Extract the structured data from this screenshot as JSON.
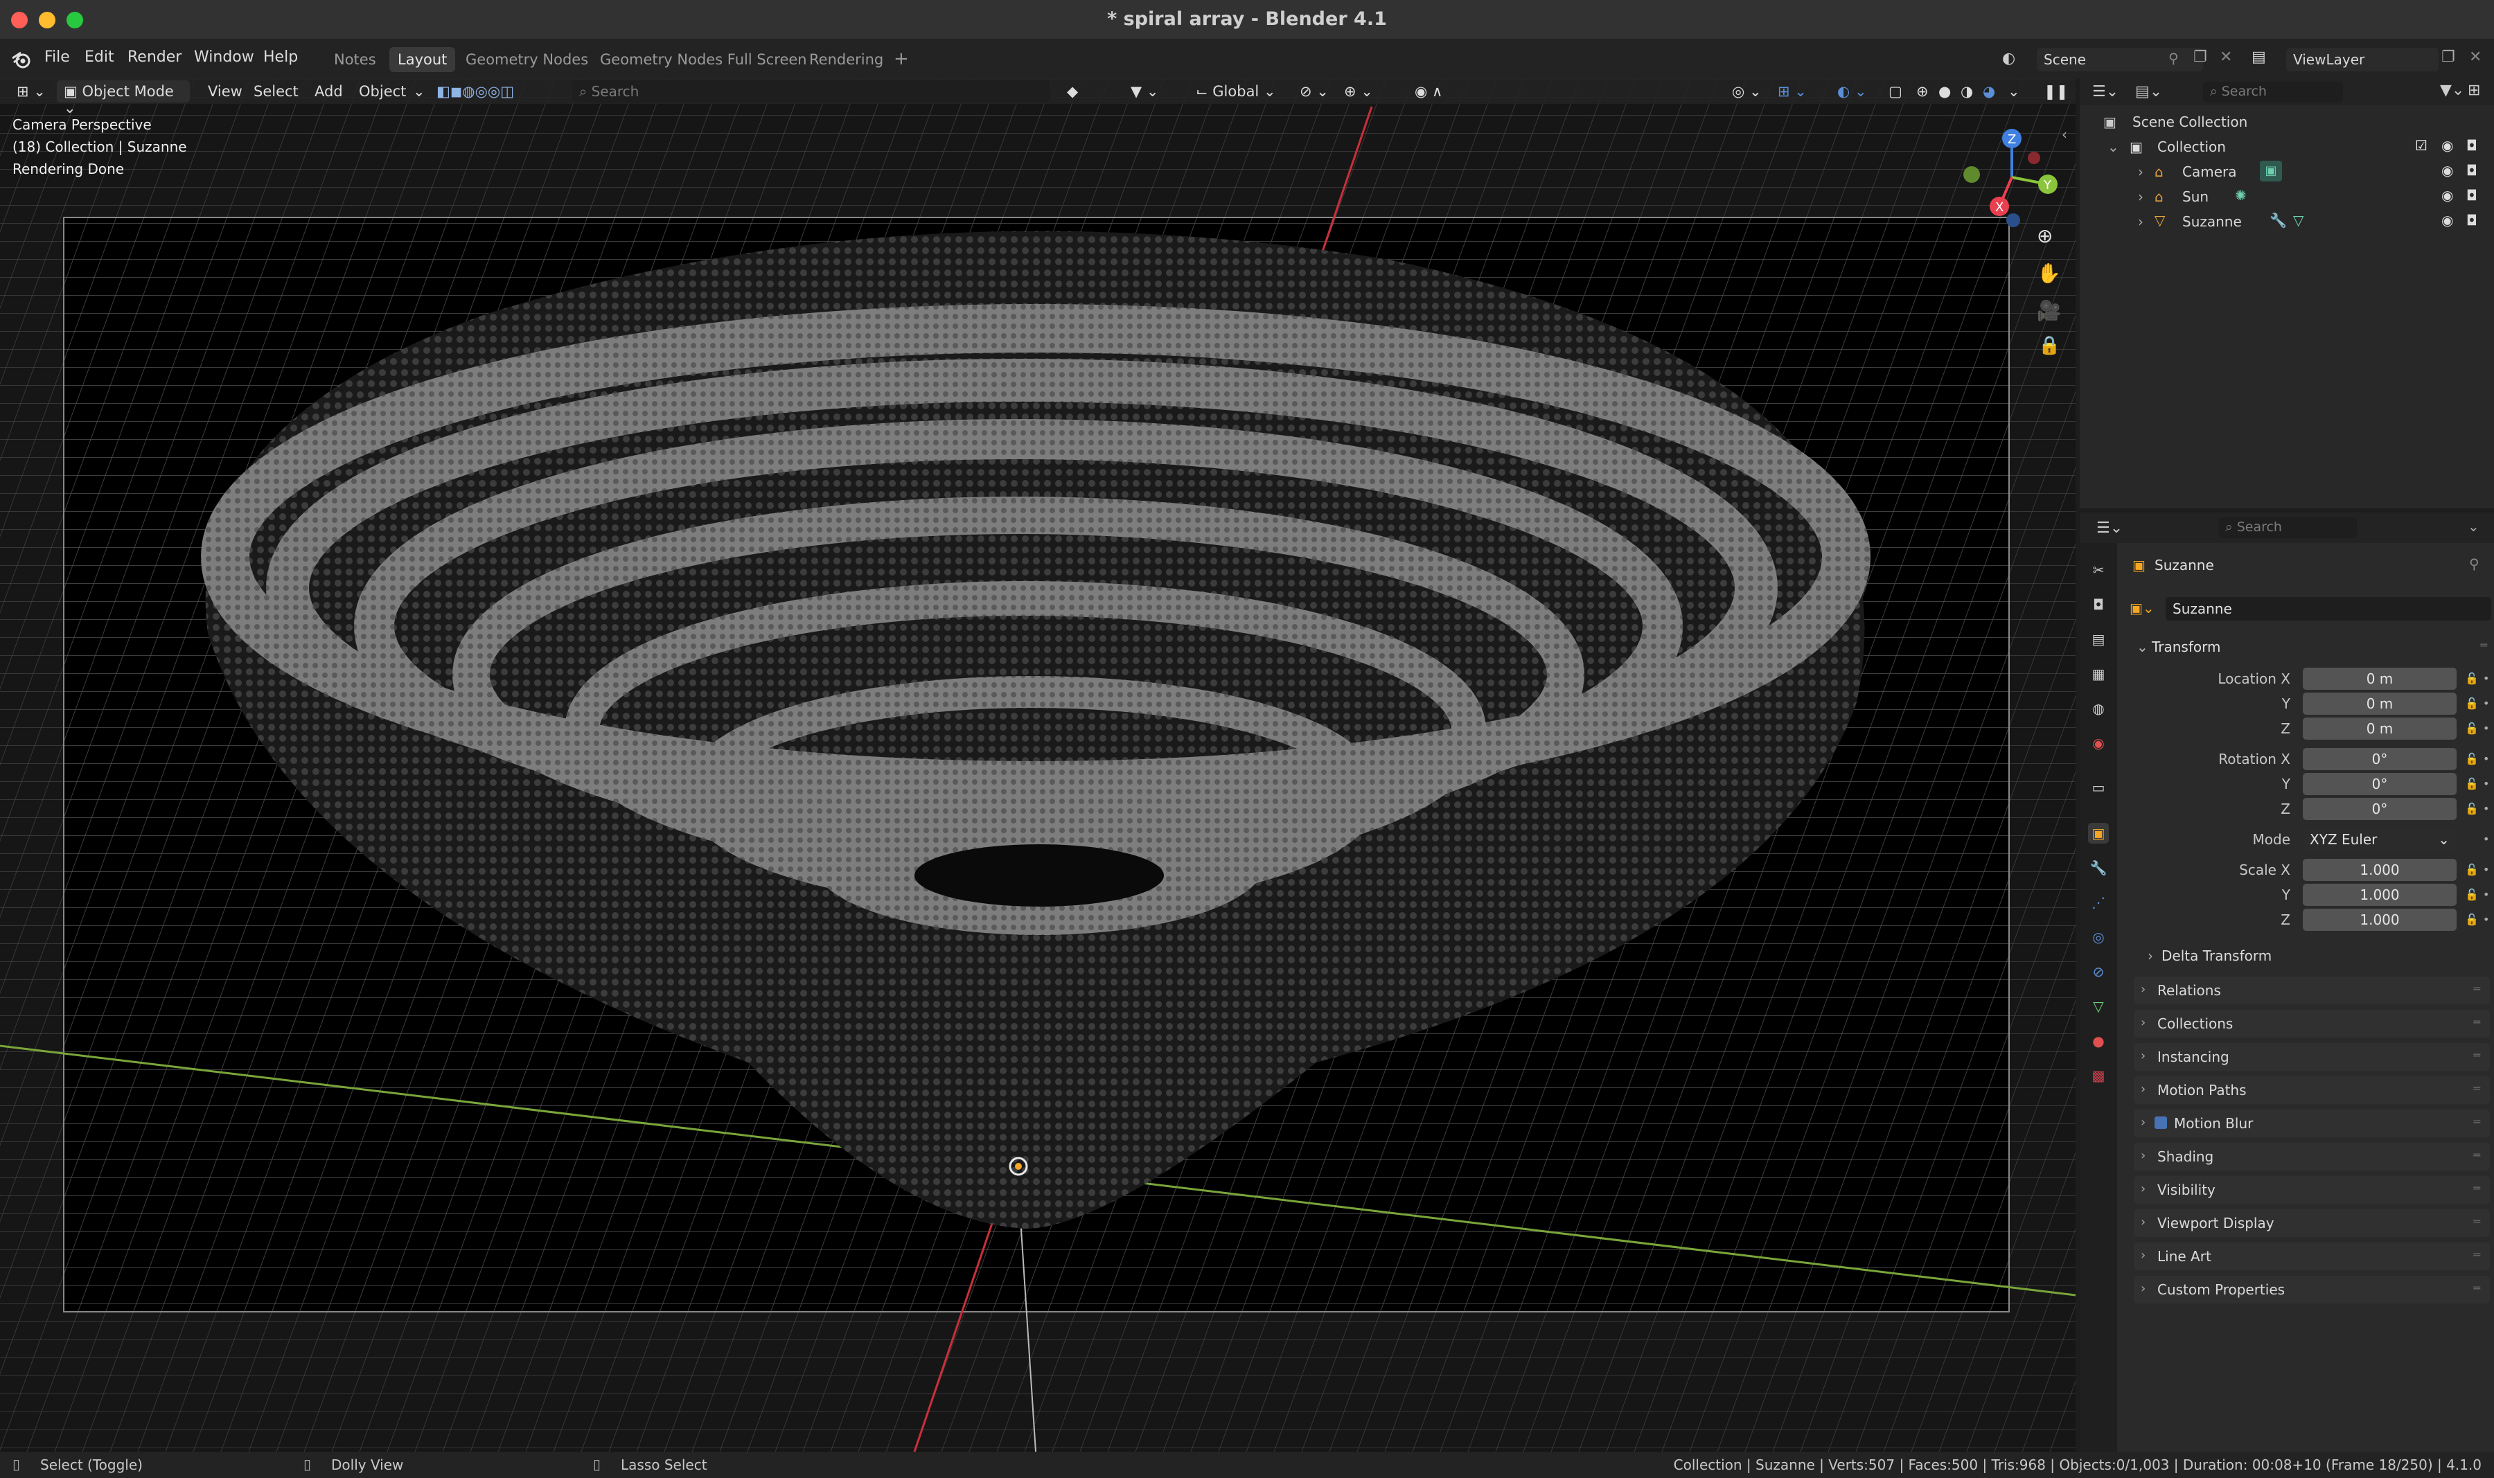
{
  "window": {
    "title": "* spiral array - Blender 4.1"
  },
  "menu": {
    "file": "File",
    "edit": "Edit",
    "render": "Render",
    "window": "Window",
    "help": "Help"
  },
  "workspaces": [
    "Notes",
    "Layout",
    "Geometry Nodes",
    "Geometry Nodes Full Screen",
    "Rendering"
  ],
  "scene": {
    "name": "Scene",
    "view_layer": "ViewLayer"
  },
  "viewport_header": {
    "mode": "Object Mode",
    "view": "View",
    "select": "Select",
    "add": "Add",
    "object": "Object",
    "search_placeholder": "Search",
    "orientation": "Global"
  },
  "viewport_overlay": {
    "line1": "Camera Perspective",
    "line2": "(18) Collection | Suzanne",
    "line3": "Rendering Done"
  },
  "gizmo": {
    "z": "Z",
    "y": "Y",
    "x": "X"
  },
  "outliner": {
    "search_placeholder": "Search",
    "scene_collection": "Scene Collection",
    "collection": "Collection",
    "items": [
      "Camera",
      "Sun",
      "Suzanne"
    ]
  },
  "properties": {
    "search_placeholder": "Search",
    "object_name": "Suzanne",
    "datablock_name": "Suzanne",
    "transform_label": "Transform",
    "location_label": "Location X",
    "rotation_label": "Rotation X",
    "scale_label": "Scale X",
    "y_label": "Y",
    "z_label": "Z",
    "mode_label": "Mode",
    "mode_value": "XYZ Euler",
    "location": [
      "0 m",
      "0 m",
      "0 m"
    ],
    "rotation": [
      "0°",
      "0°",
      "0°"
    ],
    "scale": [
      "1.000",
      "1.000",
      "1.000"
    ],
    "delta_transform": "Delta Transform",
    "panels": [
      "Relations",
      "Collections",
      "Instancing",
      "Motion Paths",
      "Motion Blur",
      "Shading",
      "Visibility",
      "Viewport Display",
      "Line Art",
      "Custom Properties"
    ]
  },
  "statusbar": {
    "left1": "Select (Toggle)",
    "left2": "Dolly View",
    "left3": "Lasso Select",
    "right": "Collection | Suzanne | Verts:507 | Faces:500 | Tris:968 | Objects:0/1,003 | Duration: 00:08+10 (Frame 18/250) | 4.1.0"
  },
  "colors": {
    "accent": "#4772b3",
    "x_axis": "#e8404f",
    "y_axis": "#8ac53c",
    "z_axis": "#3f80e0",
    "orange": "#f5a623"
  }
}
